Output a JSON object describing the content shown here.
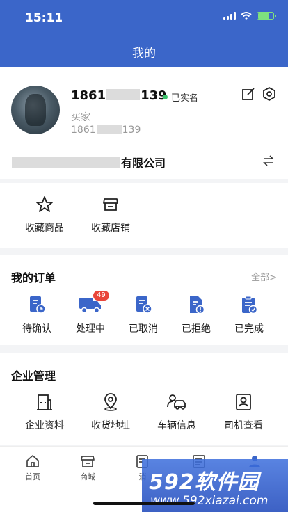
{
  "status_bar": {
    "time": "15:11"
  },
  "header": {
    "title": "我的"
  },
  "profile": {
    "phone_prefix": "1861",
    "phone_suffix": "139",
    "verified_label": "已实名",
    "role": "买家",
    "phone2_prefix": "1861",
    "phone2_suffix": "139",
    "company_suffix": "有限公司"
  },
  "favorites": {
    "items": [
      {
        "label": "收藏商品",
        "icon": "star-icon"
      },
      {
        "label": "收藏店铺",
        "icon": "store-icon"
      }
    ]
  },
  "orders": {
    "title": "我的订单",
    "more": "全部>",
    "items": [
      {
        "label": "待确认",
        "icon": "pending-doc-icon"
      },
      {
        "label": "处理中",
        "icon": "truck-icon",
        "badge": "49"
      },
      {
        "label": "已取消",
        "icon": "cancel-doc-icon"
      },
      {
        "label": "已拒绝",
        "icon": "reject-doc-icon"
      },
      {
        "label": "已完成",
        "icon": "clipboard-check-icon"
      }
    ]
  },
  "enterprise": {
    "title": "企业管理",
    "items": [
      {
        "label": "企业资料",
        "icon": "building-icon"
      },
      {
        "label": "收货地址",
        "icon": "location-icon"
      },
      {
        "label": "车辆信息",
        "icon": "vehicle-icon"
      },
      {
        "label": "司机查看",
        "icon": "driver-badge-icon"
      }
    ]
  },
  "tabbar": {
    "items": [
      {
        "label": "首页",
        "icon": "home-icon"
      },
      {
        "label": "商城",
        "icon": "shop-icon"
      },
      {
        "label": "消",
        "icon": "message-icon"
      },
      {
        "label": "",
        "icon": "document-icon"
      },
      {
        "label": "",
        "icon": "user-icon"
      }
    ]
  },
  "watermark": {
    "line1": "592软件园",
    "line2": "www.592xiazai.com"
  },
  "colors": {
    "header_bg": "#3b66c9",
    "icon_blue": "#3b66c9",
    "badge_red": "#e9463b",
    "verified_green": "#3ec46d"
  }
}
